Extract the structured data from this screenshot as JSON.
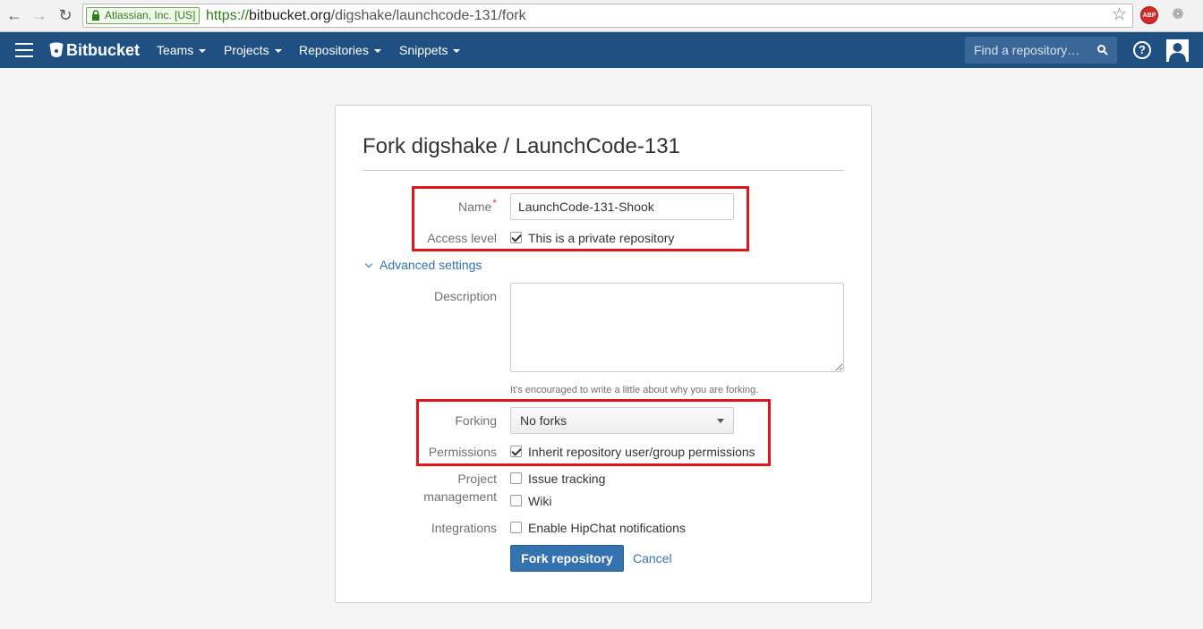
{
  "browser": {
    "ev_badge": "Atlassian, Inc. [US]",
    "url_scheme": "https://",
    "url_host": "bitbucket.org",
    "url_path": "/digshake/launchcode-131/fork",
    "ext_abp": "ABP",
    "icons": [
      "back-arrow-icon",
      "forward-arrow-icon",
      "reload-icon",
      "lock-icon",
      "star-icon",
      "adblock-icon",
      "extension-icon"
    ]
  },
  "header": {
    "logo_text": "Bitbucket",
    "nav": [
      {
        "label": "Teams"
      },
      {
        "label": "Projects"
      },
      {
        "label": "Repositories"
      },
      {
        "label": "Snippets"
      }
    ],
    "search_placeholder": "Find a repository…",
    "help_glyph": "?",
    "brand_color": "#205081"
  },
  "form": {
    "title": "Fork digshake / LaunchCode-131",
    "name_label": "Name",
    "required_mark": "*",
    "name_value": "LaunchCode-131-Shook",
    "access_label": "Access level",
    "access_checkbox_label": "This is a private repository",
    "access_checked": true,
    "advanced_label": "Advanced settings",
    "description_label": "Description",
    "description_value": "",
    "description_hint": "It's encouraged to write a little about why you are forking.",
    "forking_label": "Forking",
    "forking_value": "No forks",
    "permissions_label": "Permissions",
    "permissions_checkbox_label": "Inherit repository user/group permissions",
    "permissions_checked": true,
    "project_label_line1": "Project",
    "project_label_line2": "management",
    "issue_tracking_label": "Issue tracking",
    "issue_tracking_checked": false,
    "wiki_label": "Wiki",
    "wiki_checked": false,
    "integrations_label": "Integrations",
    "hipchat_label": "Enable HipChat notifications",
    "hipchat_checked": false,
    "submit_label": "Fork repository",
    "cancel_label": "Cancel",
    "accent_color": "#3572b0",
    "highlight_color": "#e0161c"
  }
}
